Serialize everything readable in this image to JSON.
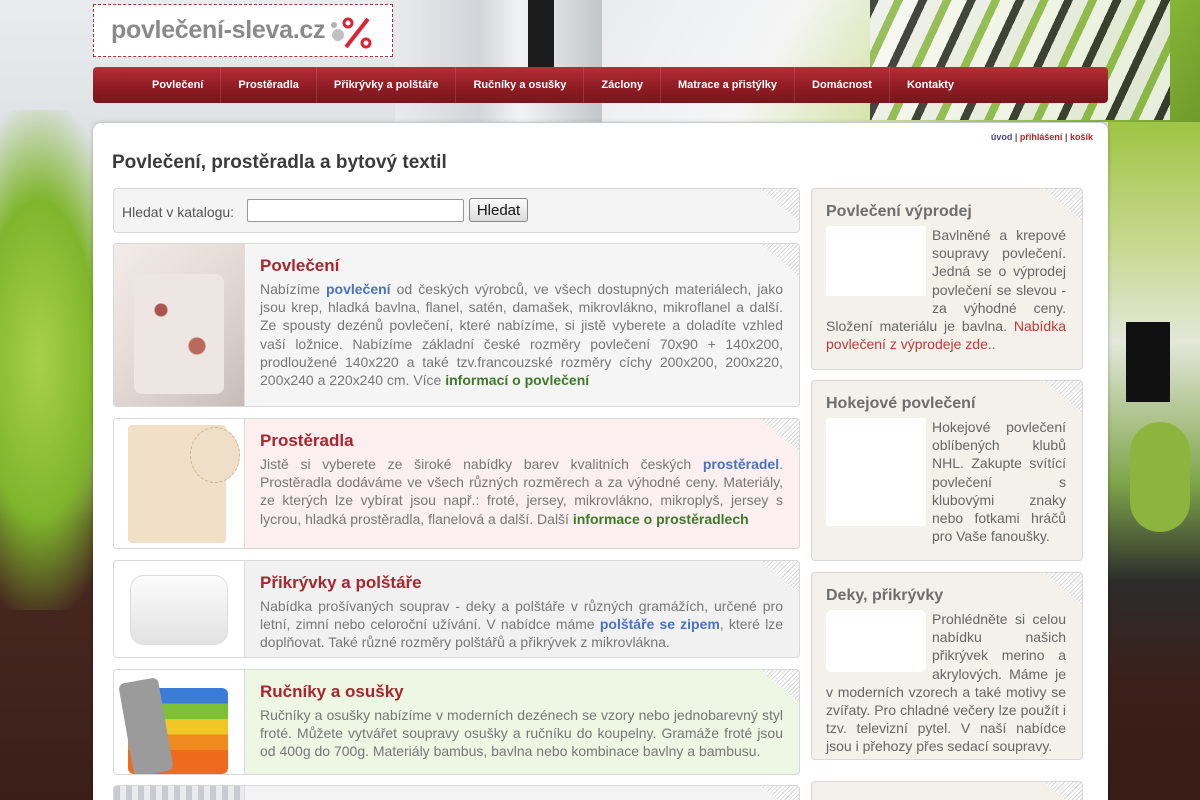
{
  "site": {
    "logo_text": "povlečení-sleva.cz",
    "page_title": "Povlečení, prostěradla a bytový textil"
  },
  "nav": {
    "items": [
      "Povlečení",
      "Prostěradla",
      "Přikrývky a polštáře",
      "Ručníky a osušky",
      "Záclony",
      "Matrace a přistýlky",
      "Domácnost",
      "Kontakty"
    ]
  },
  "top_links": {
    "home": "úvod",
    "login": "přihlášení",
    "cart": "košík",
    "sep": "|"
  },
  "search": {
    "label": "Hledat v katalogu:",
    "value": "",
    "button": "Hledat"
  },
  "products": [
    {
      "title": "Povlečení",
      "t1": "Nabízíme ",
      "link": "povlečení",
      "t2": " od českých výrobců, ve všech dostupných materiálech, jako jsou krep, hladká bavlna, flanel, satén, damašek, mikrovlákno, mikroflanel a další. Ze spousty dezénů povlečení, které nabízíme, si jistě vyberete a doladíte vzhled vaší ložnice. Nabízíme základní české rozměry povlečení 70x90 + 140x200, prodloužené 140x220 a také tzv.francouzské rozměry cíchy 200x200, 200x220, 200x240 a 220x240 cm. Více ",
      "more": "informací o povlečení",
      "t3": ""
    },
    {
      "title": "Prostěradla",
      "t1": "Jistě si vyberete ze široké nabídky barev kvalitních českých ",
      "link": "prostěradel",
      "t2": ". Prostěradla dodáváme ve všech různých rozměrech a za výhodné ceny. Materiály, ze kterých lze vybírat jsou např.: froté, jersey, mikrovlákno, mikroplyš, jersey s lycrou, hladká prostěradla, flanelová a další. Další ",
      "more": "informace o prostěradlech",
      "t3": ""
    },
    {
      "title": "Přikrývky a polštáře",
      "t1": "Nabídka prošívaných souprav - deky a polštáře v různých gramážích, určené pro letní, zimní nebo celoroční užívání. V nabídce máme ",
      "link": "polštáře se zipem",
      "t2": ", které lze doplňovat. Také různé rozměry polštářů a přikrývek z mikrovlákna.",
      "more": "",
      "t3": ""
    },
    {
      "title": "Ručníky a osušky",
      "t1": "Ručníky a osušky nabízíme v moderních dezénech se vzory nebo jednobarevný styl froté. Můžete vytvářet soupravy osušky a ručníku do koupelny. Gramáže froté jsou od 400g do 700g. Materiály bambus, bavlna nebo kombinace bavlny a bambusu.",
      "link": "",
      "t2": "",
      "more": "",
      "t3": ""
    }
  ],
  "sidebar": [
    {
      "title": "Povlečení výprodej",
      "text": "Bavlněné a krepové soupravy povlečení. Jedná se o výprodej povlečení se slevou - za výhodné ceny. Složení materiálu je bavlna. ",
      "link": "Nabídka povlečení z výprodeje zde",
      "tail": ".."
    },
    {
      "title": "Hokejové povlečení",
      "text": "Hokejové povlečení oblíbených klubů NHL. Zakupte svítící povlečení s klubovými znaky nebo fotkami hráčů pro Vaše fanoušky.",
      "link": "",
      "tail": ""
    },
    {
      "title": "Deky, přikrývky",
      "text": "Prohlédněte si celou nabídku našich přikrývek merino a akrylových. Máme je v moderních vzorech a také motivy se zvířaty. Pro chladné večery lze použít i tzv. televizní pytel. V naší nabídce jsou i přehozy přes sedací soupravy.",
      "link": "",
      "tail": ""
    }
  ],
  "colors": {
    "brand_red": "#a8262d",
    "nav_red": "#8f1c24",
    "link_blue": "#4a72c2",
    "link_green": "#3f7a2a"
  },
  "icons": {
    "logo": "percent-sale-icon"
  }
}
